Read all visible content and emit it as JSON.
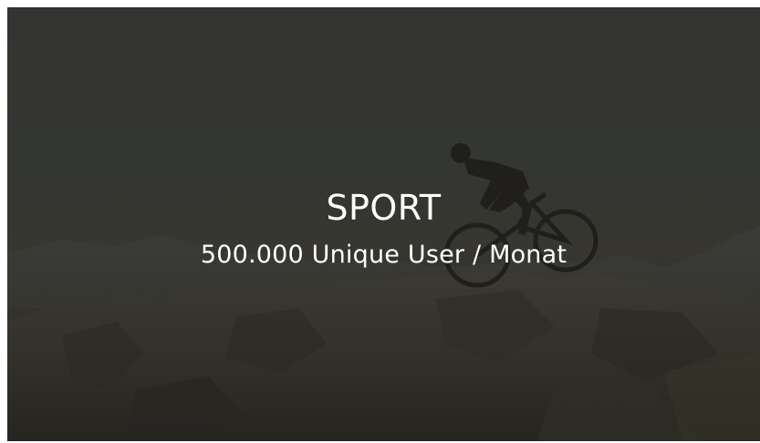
{
  "tile": {
    "title": "SPORT",
    "subtitle": "500.000 Unique User / Monat",
    "background_icon": "mountain-biker-photo",
    "overlay_color": "#141412",
    "text_color": "#ffffff"
  }
}
